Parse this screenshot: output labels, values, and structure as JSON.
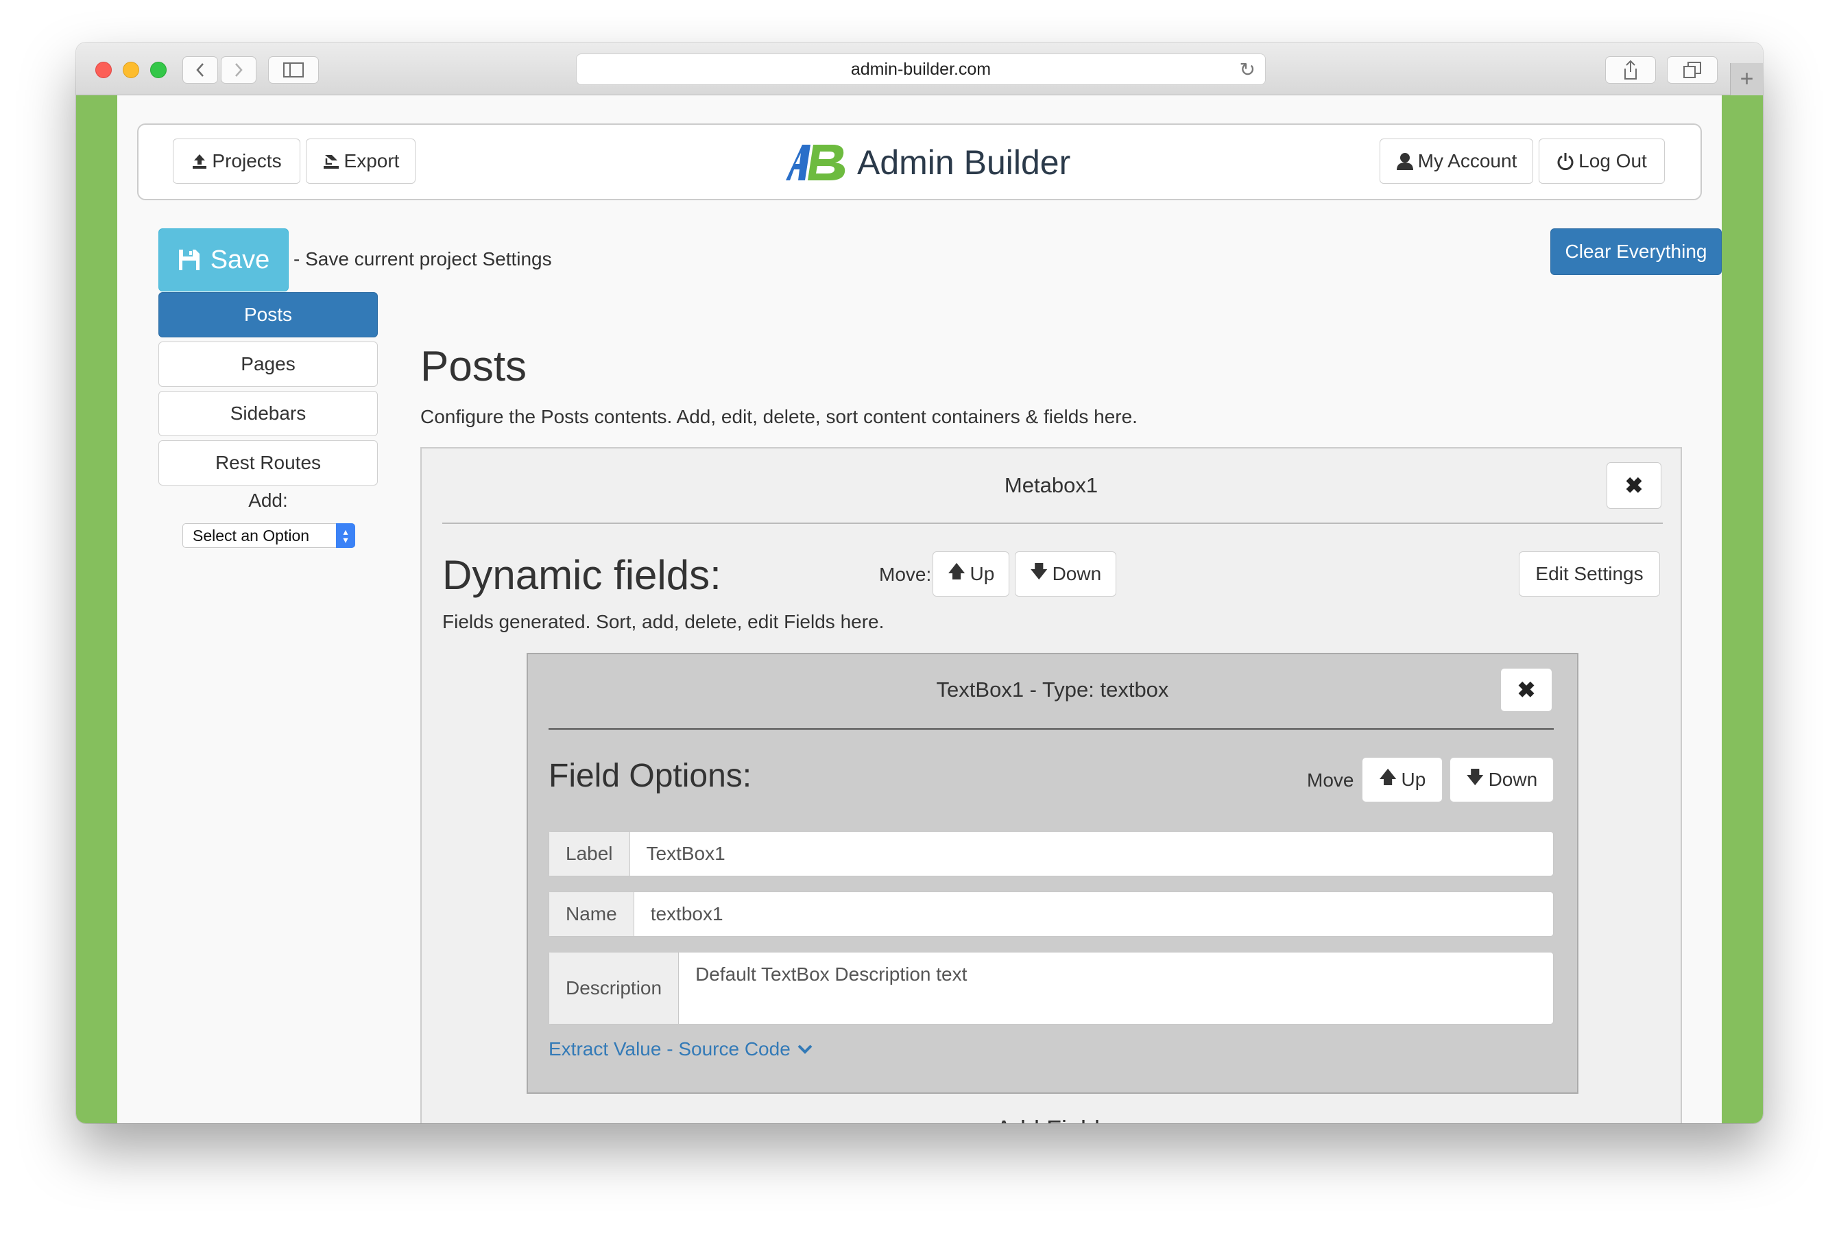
{
  "browser": {
    "url": "admin-builder.com"
  },
  "header": {
    "projects_label": "Projects",
    "export_label": "Export",
    "brand_text": "Admin Builder",
    "my_account_label": "My Account",
    "logout_label": "Log Out"
  },
  "toolbar": {
    "save_label": "Save",
    "save_hint": "- Save current project Settings",
    "clear_label": "Clear Everything"
  },
  "sidebar": {
    "items": [
      {
        "label": "Posts",
        "active": true
      },
      {
        "label": "Pages",
        "active": false
      },
      {
        "label": "Sidebars",
        "active": false
      },
      {
        "label": "Rest Routes",
        "active": false
      }
    ],
    "add_label": "Add:",
    "select_value": "Select an Option"
  },
  "main": {
    "title": "Posts",
    "description": "Configure the Posts contents. Add, edit, delete, sort content containers & fields here.",
    "metabox": {
      "title": "Metabox1",
      "dynamic_title": "Dynamic fields:",
      "move_label": "Move:",
      "up_label": "Up",
      "down_label": "Down",
      "edit_settings_label": "Edit Settings",
      "dynamic_desc": "Fields generated. Sort, add, delete, edit Fields here.",
      "add_field_label": "Add Field:",
      "field": {
        "title": "TextBox1 - Type: textbox",
        "options_title": "Field Options:",
        "move_label": "Move",
        "up_label": "Up",
        "down_label": "Down",
        "label_addon": "Label",
        "label_value": "TextBox1",
        "name_addon": "Name",
        "name_value": "textbox1",
        "description_addon": "Description",
        "description_value": "Default TextBox Description text",
        "extract_link": "Extract Value - Source Code"
      }
    }
  }
}
